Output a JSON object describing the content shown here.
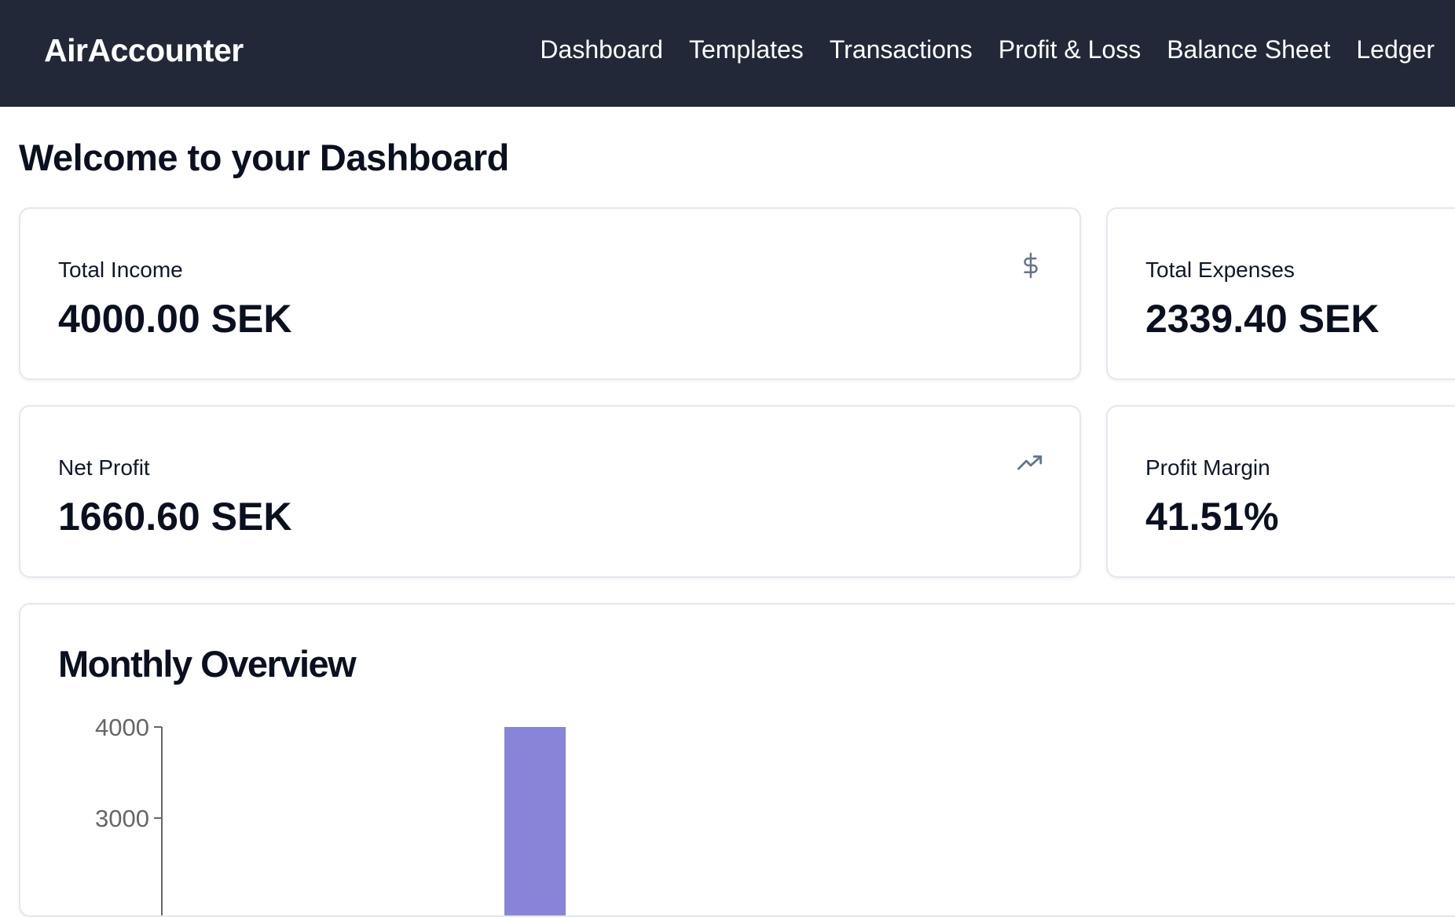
{
  "app": {
    "brand": "AirAccounter"
  },
  "nav": {
    "items": [
      {
        "label": "Dashboard"
      },
      {
        "label": "Templates"
      },
      {
        "label": "Transactions"
      },
      {
        "label": "Profit & Loss"
      },
      {
        "label": "Balance Sheet"
      },
      {
        "label": "Ledger"
      }
    ]
  },
  "page": {
    "title": "Welcome to your Dashboard"
  },
  "stats": {
    "income": {
      "label": "Total Income",
      "value": "4000.00 SEK",
      "icon": "dollar-icon"
    },
    "expenses": {
      "label": "Total Expenses",
      "value": "2339.40 SEK"
    },
    "profit": {
      "label": "Net Profit",
      "value": "1660.60 SEK",
      "icon": "trending-up-icon"
    },
    "margin": {
      "label": "Profit Margin",
      "value": "41.51%"
    }
  },
  "overview": {
    "title": "Monthly Overview"
  },
  "colors": {
    "nav_background": "#222838",
    "bar_income": "#8884d8",
    "icon_muted": "#64748b",
    "axis": "#666666"
  },
  "chart_data": {
    "type": "bar",
    "title": "",
    "xlabel": "",
    "ylabel": "",
    "yticks": [
      4000,
      3000
    ],
    "series": [
      {
        "values": [
          4000
        ],
        "color": "#8884d8"
      }
    ],
    "ylim": [
      0,
      4000
    ],
    "grid": false
  }
}
